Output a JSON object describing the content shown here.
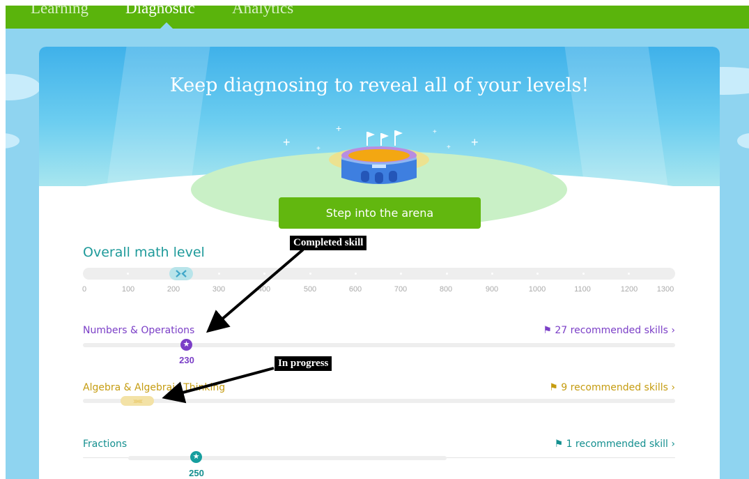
{
  "nav": {
    "tabs": [
      {
        "label": "Learning"
      },
      {
        "label": "Diagnostic",
        "active": true
      },
      {
        "label": "Analytics"
      }
    ]
  },
  "hero": {
    "title": "Keep diagnosing to reveal all of your levels!",
    "cta_label": "Step into the arena",
    "icon": "arena-stadium-icon"
  },
  "overall": {
    "title": "Overall math level",
    "ticks": [
      "0",
      "100",
      "200",
      "300",
      "400",
      "500",
      "600",
      "700",
      "800",
      "900",
      "1000",
      "1100",
      "1200",
      "1300"
    ]
  },
  "strands": [
    {
      "name": "Numbers & Operations",
      "recommended": "27 recommended skills",
      "level": "230",
      "status": "completed"
    },
    {
      "name": "Algebra & Algebraic Thinking",
      "recommended": "9 recommended skills",
      "status": "in-progress"
    },
    {
      "name": "Fractions",
      "recommended": "1 recommended skill",
      "level": "250",
      "status": "completed"
    }
  ],
  "annotations": {
    "completed": "Completed skill",
    "in_progress": "In progress"
  },
  "colors": {
    "nav_green": "#5ab40c",
    "sky": "#8fd4f0",
    "teal": "#1e9a9a",
    "purple": "#7b3fc7",
    "gold": "#c59c10",
    "fractions_teal": "#138f8f",
    "cta_green": "#62b70f"
  }
}
